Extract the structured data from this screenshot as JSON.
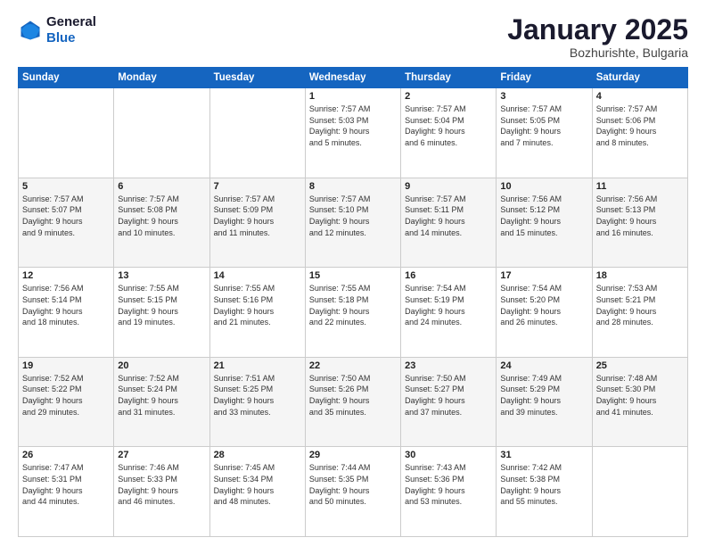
{
  "header": {
    "logo_line1": "General",
    "logo_line2": "Blue",
    "month": "January 2025",
    "location": "Bozhurishte, Bulgaria"
  },
  "weekdays": [
    "Sunday",
    "Monday",
    "Tuesday",
    "Wednesday",
    "Thursday",
    "Friday",
    "Saturday"
  ],
  "weeks": [
    [
      {
        "day": "",
        "text": ""
      },
      {
        "day": "",
        "text": ""
      },
      {
        "day": "",
        "text": ""
      },
      {
        "day": "1",
        "text": "Sunrise: 7:57 AM\nSunset: 5:03 PM\nDaylight: 9 hours\nand 5 minutes."
      },
      {
        "day": "2",
        "text": "Sunrise: 7:57 AM\nSunset: 5:04 PM\nDaylight: 9 hours\nand 6 minutes."
      },
      {
        "day": "3",
        "text": "Sunrise: 7:57 AM\nSunset: 5:05 PM\nDaylight: 9 hours\nand 7 minutes."
      },
      {
        "day": "4",
        "text": "Sunrise: 7:57 AM\nSunset: 5:06 PM\nDaylight: 9 hours\nand 8 minutes."
      }
    ],
    [
      {
        "day": "5",
        "text": "Sunrise: 7:57 AM\nSunset: 5:07 PM\nDaylight: 9 hours\nand 9 minutes."
      },
      {
        "day": "6",
        "text": "Sunrise: 7:57 AM\nSunset: 5:08 PM\nDaylight: 9 hours\nand 10 minutes."
      },
      {
        "day": "7",
        "text": "Sunrise: 7:57 AM\nSunset: 5:09 PM\nDaylight: 9 hours\nand 11 minutes."
      },
      {
        "day": "8",
        "text": "Sunrise: 7:57 AM\nSunset: 5:10 PM\nDaylight: 9 hours\nand 12 minutes."
      },
      {
        "day": "9",
        "text": "Sunrise: 7:57 AM\nSunset: 5:11 PM\nDaylight: 9 hours\nand 14 minutes."
      },
      {
        "day": "10",
        "text": "Sunrise: 7:56 AM\nSunset: 5:12 PM\nDaylight: 9 hours\nand 15 minutes."
      },
      {
        "day": "11",
        "text": "Sunrise: 7:56 AM\nSunset: 5:13 PM\nDaylight: 9 hours\nand 16 minutes."
      }
    ],
    [
      {
        "day": "12",
        "text": "Sunrise: 7:56 AM\nSunset: 5:14 PM\nDaylight: 9 hours\nand 18 minutes."
      },
      {
        "day": "13",
        "text": "Sunrise: 7:55 AM\nSunset: 5:15 PM\nDaylight: 9 hours\nand 19 minutes."
      },
      {
        "day": "14",
        "text": "Sunrise: 7:55 AM\nSunset: 5:16 PM\nDaylight: 9 hours\nand 21 minutes."
      },
      {
        "day": "15",
        "text": "Sunrise: 7:55 AM\nSunset: 5:18 PM\nDaylight: 9 hours\nand 22 minutes."
      },
      {
        "day": "16",
        "text": "Sunrise: 7:54 AM\nSunset: 5:19 PM\nDaylight: 9 hours\nand 24 minutes."
      },
      {
        "day": "17",
        "text": "Sunrise: 7:54 AM\nSunset: 5:20 PM\nDaylight: 9 hours\nand 26 minutes."
      },
      {
        "day": "18",
        "text": "Sunrise: 7:53 AM\nSunset: 5:21 PM\nDaylight: 9 hours\nand 28 minutes."
      }
    ],
    [
      {
        "day": "19",
        "text": "Sunrise: 7:52 AM\nSunset: 5:22 PM\nDaylight: 9 hours\nand 29 minutes."
      },
      {
        "day": "20",
        "text": "Sunrise: 7:52 AM\nSunset: 5:24 PM\nDaylight: 9 hours\nand 31 minutes."
      },
      {
        "day": "21",
        "text": "Sunrise: 7:51 AM\nSunset: 5:25 PM\nDaylight: 9 hours\nand 33 minutes."
      },
      {
        "day": "22",
        "text": "Sunrise: 7:50 AM\nSunset: 5:26 PM\nDaylight: 9 hours\nand 35 minutes."
      },
      {
        "day": "23",
        "text": "Sunrise: 7:50 AM\nSunset: 5:27 PM\nDaylight: 9 hours\nand 37 minutes."
      },
      {
        "day": "24",
        "text": "Sunrise: 7:49 AM\nSunset: 5:29 PM\nDaylight: 9 hours\nand 39 minutes."
      },
      {
        "day": "25",
        "text": "Sunrise: 7:48 AM\nSunset: 5:30 PM\nDaylight: 9 hours\nand 41 minutes."
      }
    ],
    [
      {
        "day": "26",
        "text": "Sunrise: 7:47 AM\nSunset: 5:31 PM\nDaylight: 9 hours\nand 44 minutes."
      },
      {
        "day": "27",
        "text": "Sunrise: 7:46 AM\nSunset: 5:33 PM\nDaylight: 9 hours\nand 46 minutes."
      },
      {
        "day": "28",
        "text": "Sunrise: 7:45 AM\nSunset: 5:34 PM\nDaylight: 9 hours\nand 48 minutes."
      },
      {
        "day": "29",
        "text": "Sunrise: 7:44 AM\nSunset: 5:35 PM\nDaylight: 9 hours\nand 50 minutes."
      },
      {
        "day": "30",
        "text": "Sunrise: 7:43 AM\nSunset: 5:36 PM\nDaylight: 9 hours\nand 53 minutes."
      },
      {
        "day": "31",
        "text": "Sunrise: 7:42 AM\nSunset: 5:38 PM\nDaylight: 9 hours\nand 55 minutes."
      },
      {
        "day": "",
        "text": ""
      }
    ]
  ]
}
